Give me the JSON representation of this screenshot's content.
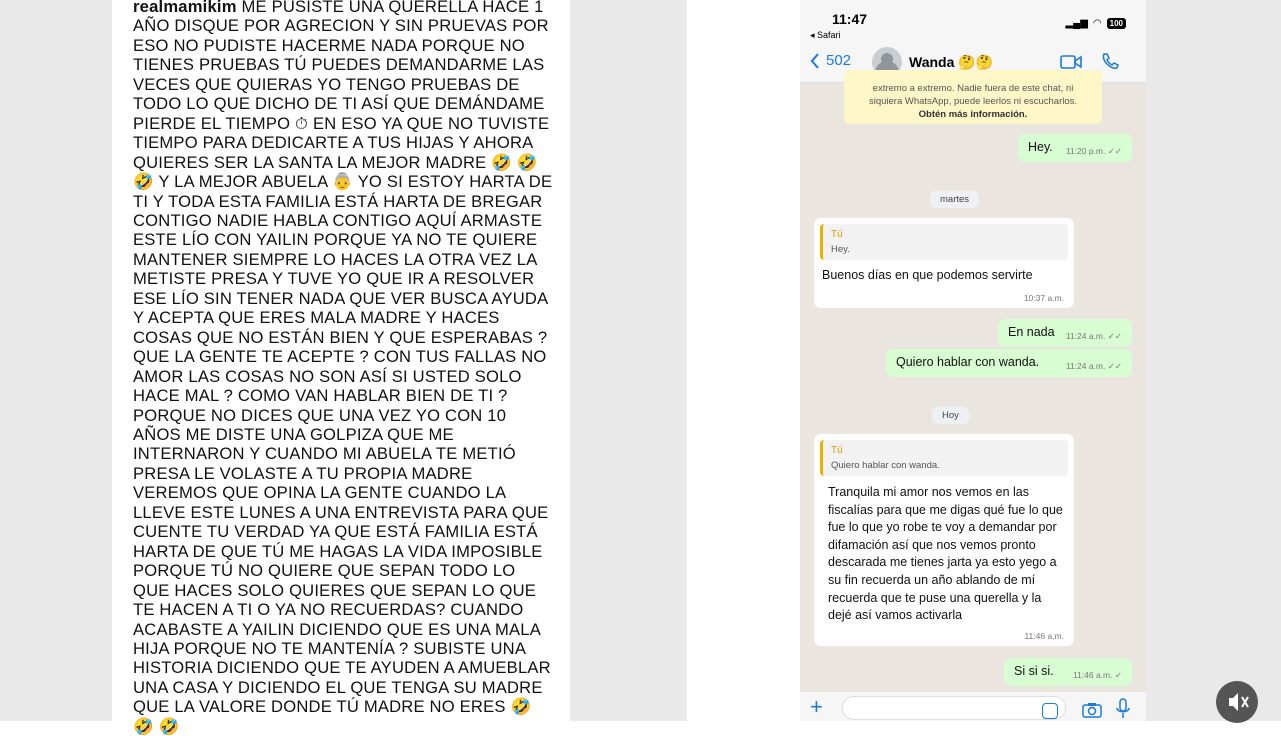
{
  "post": {
    "username": "realmamikim",
    "body": " ME PUSISTE UNA QUERELLA HACE 1 AÑO DISQUE POR AGRECION Y SIN PRUEVAS POR ESO NO PUDISTE HACERME NADA PORQUE NO TIENES PRUEBAS TÚ PUEDES DEMANDARME LAS VECES QUE QUIERAS YO TENGO PRUEBAS DE TODO LO QUE DICHO DE TI ASÍ QUE DEMÁNDAME PIERDE EL TIEMPO ⏱ EN ESO YA QUE NO TUVISTE TIEMPO PARA DEDICARTE A TUS HIJAS Y AHORA QUIERES SER LA SANTA LA MEJOR MADRE 🤣 🤣 🤣 Y LA MEJOR ABUELA 👵 YO SI ESTOY HARTA DE TI Y TODA ESTA FAMILIA ESTÁ HARTA DE BREGAR CONTIGO NADIE HABLA CONTIGO AQUÍ ARMASTE ESTE LÍO CON YAILIN PORQUE YA NO TE QUIERE MANTENER SIEMPRE LO HACES LA OTRA VEZ LA METISTE PRESA Y TUVE YO QUE IR A RESOLVER ESE LÍO SIN TENER NADA QUE VER BUSCA AYUDA Y ACEPTA QUE ERES MALA MADRE Y HACES COSAS QUE NO ESTÁN BIEN Y QUE ESPERABAS ? QUE LA GENTE TE ACEPTE ? CON TUS FALLAS NO AMOR LAS COSAS NO SON ASÍ SI USTED SOLO HACE MAL ? COMO VAN HABLAR BIEN DE TI ?  PORQUE NO DICES QUE UNA VEZ YO CON 10 AÑOS ME DISTE UNA GOLPIZA QUE ME INTERNARON Y CUANDO MI ABUELA TE METIÓ PRESA LE VOLASTE A TU PROPIA MADRE VEREMOS QUE OPINA LA GENTE CUANDO LA LLEVE ESTE LUNES A UNA ENTREVISTA PARA QUE CUENTE TU VERDAD YA QUE ESTÁ FAMILIA ESTÁ HARTA DE QUE TÚ ME HAGAS LA VIDA IMPOSIBLE  PORQUE TÚ NO QUIERE QUE SEPAN TODO LO QUE HACES SOLO QUIERES QUE SEPAN LO QUE TE HACEN A TI O YA NO RECUERDAS?  CUANDO ACABASTE A YAILIN DICIENDO QUE ES UNA MALA HIJA PORQUE NO TE MANTENÍA ? SUBISTE UNA HISTORIA DICIENDO QUE TE AYUDEN A  AMUEBLAR UNA CASA Y DICIENDO EL QUE TENGA SU MADRE QUE LA VALORE DONDE TÚ MADRE NO ERES 🤣 🤣 🤣"
  },
  "phone": {
    "status": {
      "time": "11:47",
      "back_app": "◂ Safari",
      "battery": "100"
    },
    "nav": {
      "back_count": "502",
      "contact_name": "Wanda 🤔🤔"
    },
    "system_note": {
      "line1": "extremo a extremo. Nadie fuera de este chat, ni",
      "line2": "siquiera WhatsApp, puede leerlos ni escucharlos.",
      "link": "Obtén más información."
    },
    "messages": [
      {
        "dir": "out",
        "text": "Hey.",
        "time": "11:20 p.m."
      },
      {
        "date": "martes"
      },
      {
        "dir": "in",
        "quote_name": "Tú",
        "quote_text": "Hey.",
        "text": "Buenos días en que podemos servirte",
        "time": "10:37 a.m."
      },
      {
        "dir": "out",
        "text": "En nada",
        "time": "11:24 a.m."
      },
      {
        "dir": "out",
        "text": "Quiero hablar con wanda.",
        "time": "11:24 a.m."
      },
      {
        "date": "Hoy"
      },
      {
        "dir": "in",
        "quote_name": "Tú",
        "quote_text": "Quiero hablar con wanda.",
        "text": "Tranquila mi amor nos vemos en las fiscalías para que me digas qué fue lo que fue lo que yo robe te voy a demandar por difamación así que nos vemos pronto descarada me tienes jarta ya esto yego a su fin recuerda  un año ablando de mí recuerda que te puse una querella y la dejé así vamos activarla",
        "time": "11:46 a.m."
      },
      {
        "dir": "out",
        "text": "Si si si.",
        "time": "11:46 a.m."
      }
    ]
  },
  "icons": {
    "video": "video-call-icon",
    "phone": "phone-call-icon",
    "plus": "plus-icon",
    "camera": "camera-icon",
    "mic": "microphone-icon",
    "mute": "muted-speaker-icon"
  }
}
